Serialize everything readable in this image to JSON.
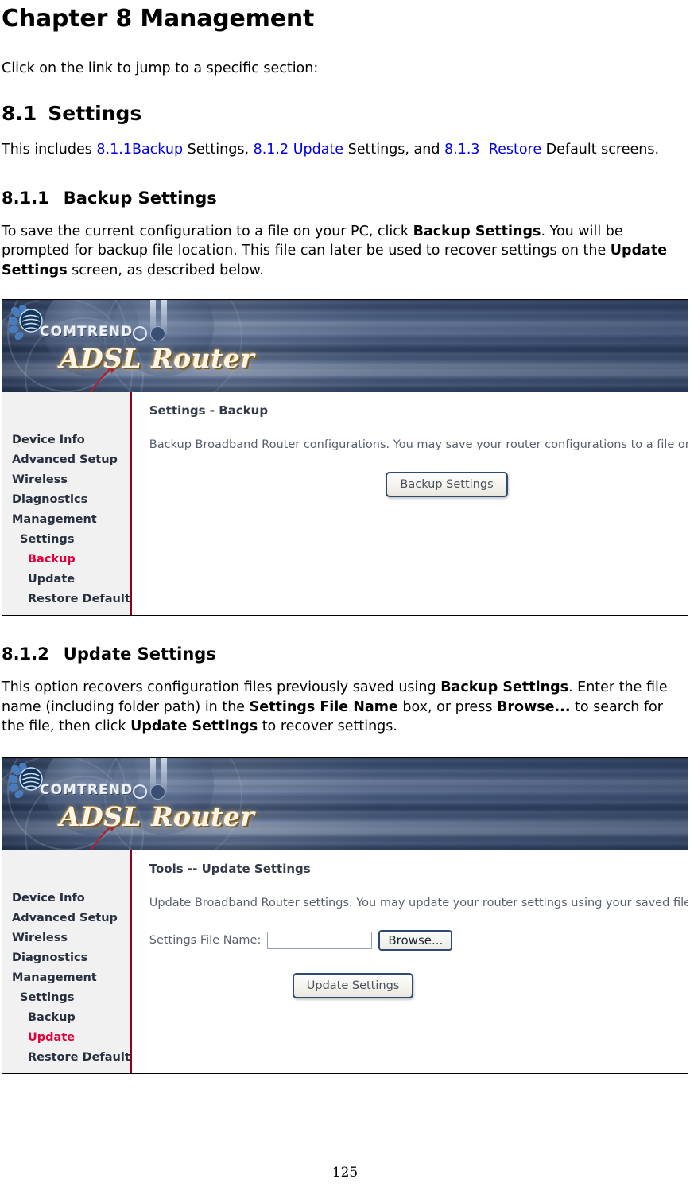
{
  "document": {
    "chapter_title": "Chapter 8 Management",
    "intro_line": "Click on the link to jump to a specific section:",
    "page_number": "125",
    "section_81": {
      "number": "8.1",
      "title": "Settings",
      "para_lead": "This includes ",
      "link1_num": "8.1.1",
      "link1_text": "Backup",
      "para_mid1": " Settings, ",
      "link2_num": "8.1.2",
      "link2_text": "Update",
      "para_mid2": " Settings, and ",
      "link3_num": "8.1.3",
      "link3_text": "Restore",
      "para_tail": " Default screens."
    },
    "section_811": {
      "number": "8.1.1",
      "title": "Backup Settings",
      "p1_a": "To save the current configuration to a file on your PC, click ",
      "p1_b": "Backup Settings",
      "p1_c": ".   You will be prompted for backup file location. This file can later be used to recover settings on the ",
      "p1_d": "Update Settings",
      "p1_e": " screen, as described below."
    },
    "section_812": {
      "number": "8.1.2",
      "title": "Update Settings",
      "p1_a": "This option recovers configuration files previously saved using ",
      "p1_b": "Backup Settings",
      "p1_c": ". Enter the file name (including folder path) in the ",
      "p1_d": "Settings File Name",
      "p1_e": " box, or press ",
      "p1_f": "Browse...",
      "p1_g": " to search for the file, then click ",
      "p1_h": "Update Settings",
      "p1_i": " to recover settings."
    }
  },
  "colors": {
    "link": "#0000ee",
    "nav_active": "#e4003a",
    "nav_divider": "#8c0020",
    "button_border": "#2c4a72",
    "sidebar_bg": "#f1f1f1"
  },
  "screenshot_backup": {
    "brand": "COMTREND",
    "product": "ADSL Router",
    "nav": [
      {
        "label": "Device Info",
        "level": 1,
        "active": false
      },
      {
        "label": "Advanced Setup",
        "level": 1,
        "active": false
      },
      {
        "label": "Wireless",
        "level": 1,
        "active": false
      },
      {
        "label": "Diagnostics",
        "level": 1,
        "active": false
      },
      {
        "label": "Management",
        "level": 1,
        "active": false
      },
      {
        "label": "Settings",
        "level": 2,
        "active": false
      },
      {
        "label": "Backup",
        "level": 3,
        "active": true
      },
      {
        "label": "Update",
        "level": 3,
        "active": false
      },
      {
        "label": "Restore Default",
        "level": 3,
        "active": false
      }
    ],
    "panel_title": "Settings - Backup",
    "panel_desc": "Backup Broadband Router configurations. You may save your router configurations to a file on your PC.",
    "button_label": "Backup Settings"
  },
  "screenshot_update": {
    "brand": "COMTREND",
    "product": "ADSL Router",
    "nav": [
      {
        "label": "Device Info",
        "level": 1,
        "active": false
      },
      {
        "label": "Advanced Setup",
        "level": 1,
        "active": false
      },
      {
        "label": "Wireless",
        "level": 1,
        "active": false
      },
      {
        "label": "Diagnostics",
        "level": 1,
        "active": false
      },
      {
        "label": "Management",
        "level": 1,
        "active": false
      },
      {
        "label": "Settings",
        "level": 2,
        "active": false
      },
      {
        "label": "Backup",
        "level": 3,
        "active": false
      },
      {
        "label": "Update",
        "level": 3,
        "active": true
      },
      {
        "label": "Restore Default",
        "level": 3,
        "active": false
      }
    ],
    "panel_title": "Tools -- Update Settings",
    "panel_desc": "Update Broadband Router settings. You may update your router settings using your saved files.",
    "field_label": "Settings File Name:",
    "field_value": "",
    "browse_label": "Browse...",
    "button_label": "Update Settings"
  }
}
